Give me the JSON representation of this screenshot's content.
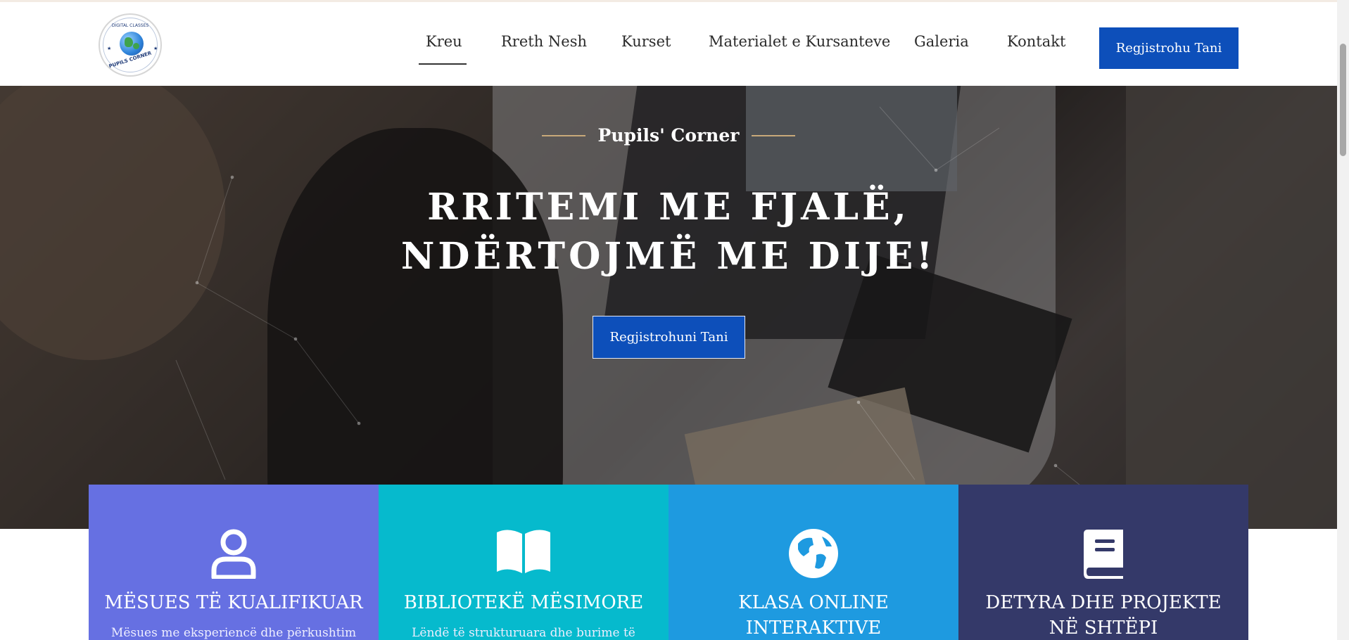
{
  "header": {
    "logo": {
      "top_text": "DIGITAL CLASSES",
      "bottom_text": "PUPILS CORNER"
    },
    "nav": [
      {
        "label": "Kreu",
        "active": true
      },
      {
        "label": "Rreth Nesh"
      },
      {
        "label": "Kurset"
      },
      {
        "label": "Materialet e Kursanteve"
      },
      {
        "label": "Galeria"
      },
      {
        "label": "Kontakt"
      }
    ],
    "cta_label": "Regjistrohu Tani"
  },
  "hero": {
    "eyebrow": "Pupils' Corner",
    "headline_line1": "RRITEMI ME FJALË,",
    "headline_line2": "NDËRTOJMË ME DIJE!",
    "button_label": "Regjistrohuni Tani"
  },
  "cards": [
    {
      "icon": "user-icon",
      "color": "#6670e2",
      "title": "MËSUES TË KUALIFIKUAR",
      "desc": "Mësues me eksperiencë dhe përkushtim"
    },
    {
      "icon": "book-open-icon",
      "color": "#06bacd",
      "title": "BIBLIOTEKË MËSIMORE",
      "desc": "Lëndë të strukturuara dhe burime të"
    },
    {
      "icon": "globe-icon",
      "color": "#1e9ae0",
      "title": "KLASA ONLINE INTERAKTIVE",
      "desc": ""
    },
    {
      "icon": "book-icon",
      "color": "#343969",
      "title": "DETYRA DHE PROJEKTE NË SHTËPI",
      "desc": ""
    }
  ],
  "colors": {
    "primary": "#0d4fba",
    "accent_line": "#c8a979"
  }
}
